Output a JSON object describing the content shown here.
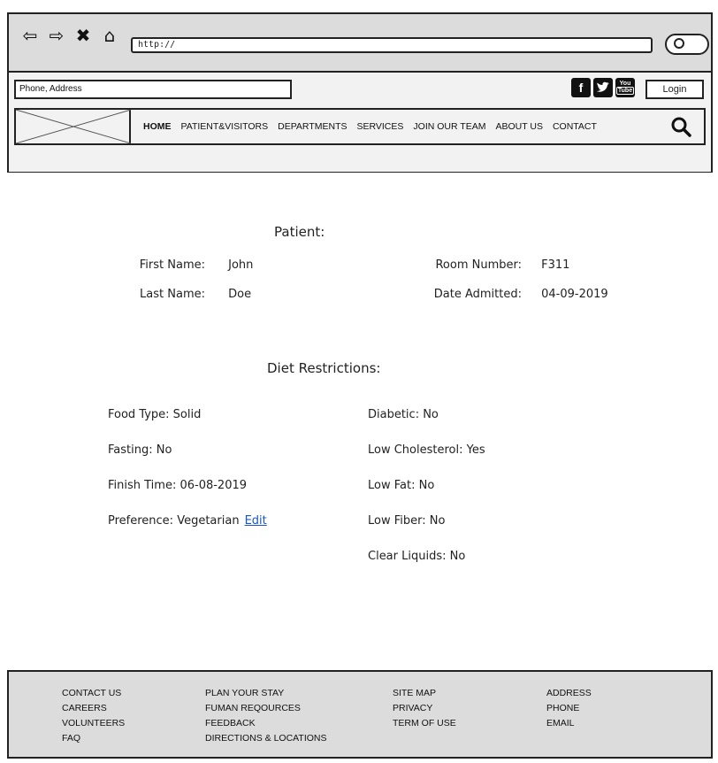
{
  "browser": {
    "back_icon": "back-arrow",
    "forward_icon": "forward-arrow",
    "close_icon": "close-x",
    "home_icon": "home",
    "url": "http://"
  },
  "header": {
    "contact_placeholder": "Phone, Address",
    "social": {
      "facebook": "f",
      "twitter": "t",
      "youtube_line1": "You",
      "youtube_line2": "Tube"
    },
    "login_label": "Login",
    "nav": [
      "HOME",
      "PATIENT&VISITORS",
      "DEPARTMENTS",
      "SERVICES",
      "JOIN OUR TEAM",
      "ABOUT US",
      "CONTACT"
    ]
  },
  "patient": {
    "title": "Patient:",
    "first_name_label": "First Name:",
    "first_name": "John",
    "last_name_label": "Last Name:",
    "last_name": "Doe",
    "room_label": "Room Number:",
    "room": "F311",
    "admitted_label": "Date Admitted:",
    "admitted": "04-09-2019"
  },
  "diet": {
    "title": "Diet Restrictions:",
    "food_type": "Food Type: Solid",
    "fasting": "Fasting: No",
    "finish_time": "Finish Time:  06-08-2019",
    "preference": "Preference: Vegetarian",
    "edit_label": "Edit",
    "diabetic": "Diabetic:  No",
    "low_cholesterol": "Low Cholesterol: Yes",
    "low_fat": "Low Fat:  No",
    "low_fiber": "Low Fiber: No",
    "clear_liquids": "Clear Liquids:  No"
  },
  "footer": {
    "col1": [
      "CONTACT US",
      "CAREERS",
      "VOLUNTEERS",
      "FAQ"
    ],
    "col2": [
      "PLAN YOUR STAY",
      "FUMAN REQOURCES",
      "FEEDBACK",
      "DIRECTIONS & LOCATIONS"
    ],
    "col3": [
      "SITE MAP",
      "PRIVACY",
      "TERM OF USE"
    ],
    "col4": [
      "ADDRESS",
      "PHONE",
      "EMAIL"
    ]
  }
}
